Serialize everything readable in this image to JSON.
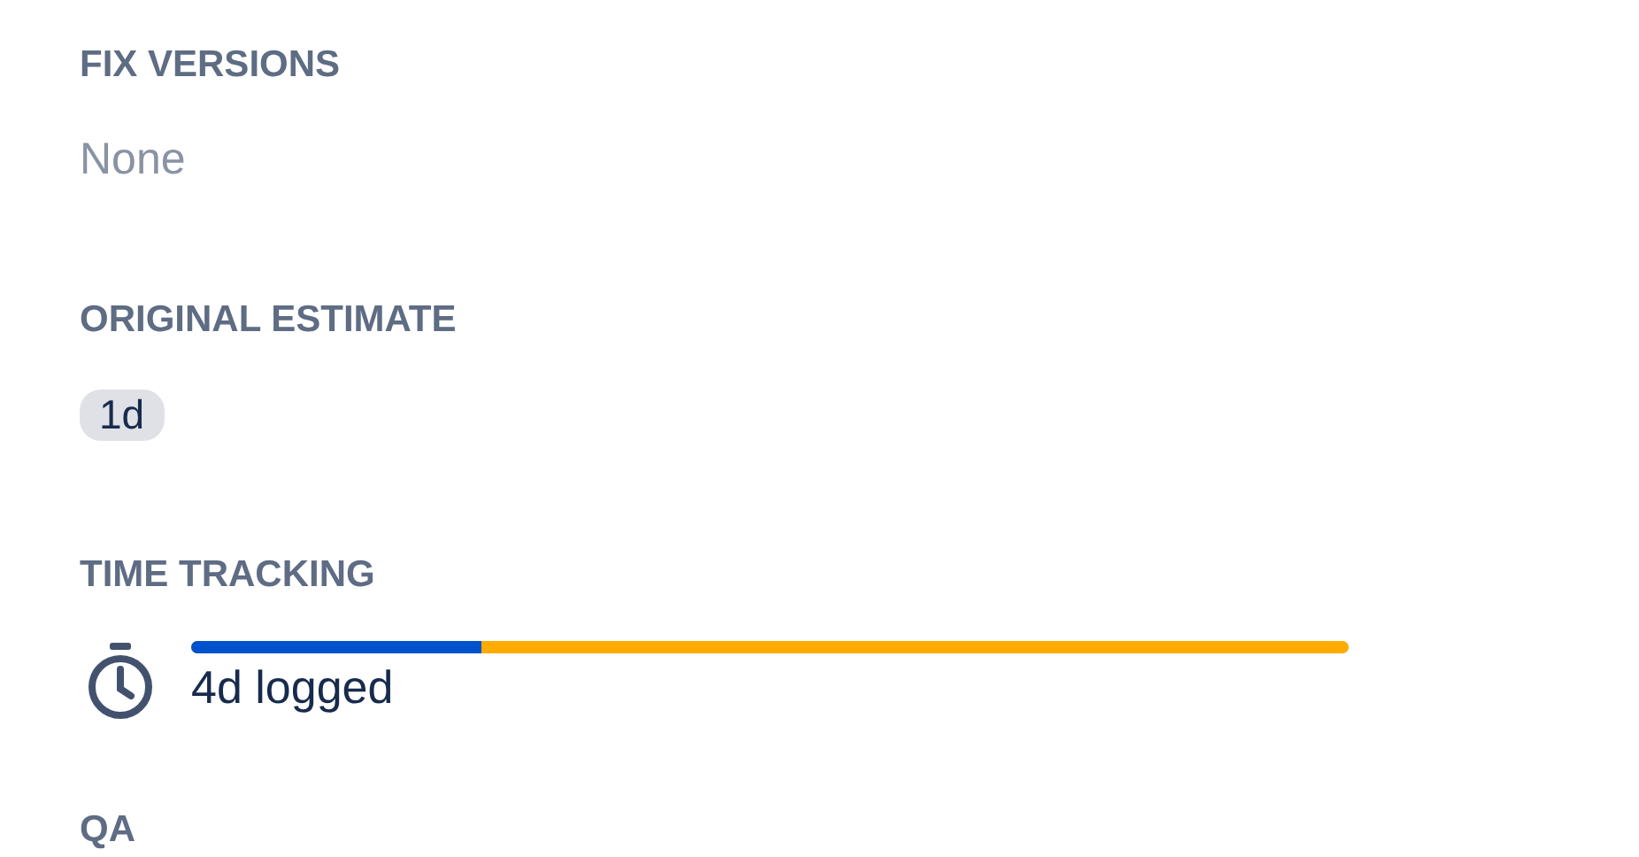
{
  "fields": [
    {
      "kind": "text",
      "label": "FIX VERSIONS",
      "value": "None"
    },
    {
      "kind": "badge",
      "label": "ORIGINAL ESTIMATE",
      "value": "1d"
    },
    {
      "kind": "tracking",
      "label": "TIME TRACKING",
      "value": "4d logged",
      "level": 0.25
    },
    {
      "kind": "empty",
      "label": "QA"
    }
  ]
}
